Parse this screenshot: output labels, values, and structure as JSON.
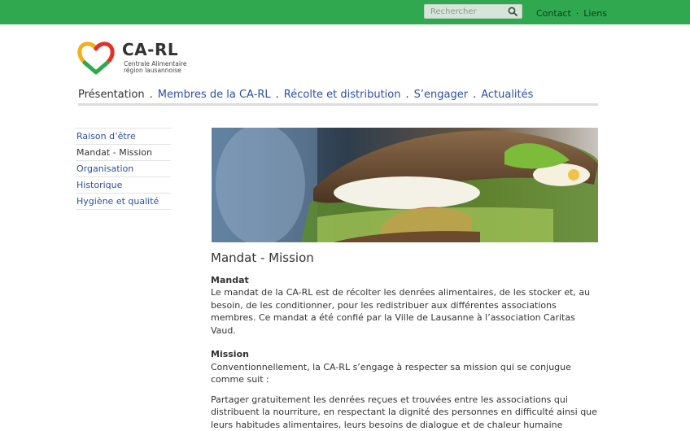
{
  "topbar": {
    "search_placeholder": "Rechercher",
    "links": [
      "Contact",
      "Liens"
    ]
  },
  "logo": {
    "name": "CA-RL",
    "subtitle_line1": "Centrale Alimentaire",
    "subtitle_line2": "région lausannoise"
  },
  "mainnav": {
    "items": [
      "Présentation",
      "Membres de la CA-RL",
      "Récolte et distribution",
      "S’engager",
      "Actualités"
    ],
    "active_index": 0
  },
  "sidenav": {
    "items": [
      "Raison d’être",
      "Mandat - Mission",
      "Organisation",
      "Historique",
      "Hygiène et qualité"
    ],
    "active_index": 1
  },
  "content": {
    "title": "Mandat - Mission",
    "mandat_heading": "Mandat",
    "mandat_text": "Le mandat de la CA-RL est de récolter les denrées alimentaires, de les stocker et, au besoin, de les conditionner, pour les redistribuer aux différentes associations membres. Ce mandat a été confié par la Ville de Lausanne à l’association Caritas Vaud.",
    "mission_heading": "Mission",
    "mission_intro": "Conventionnellement, la CA-RL s’engage à respecter sa mission qui se conjugue comme suit :",
    "mission_point": "Partager gratuitement les denrées reçues et trouvées entre les associations qui distribuent la nourriture, en respectant la dignité des personnes en difficulté ainsi que leurs habitudes alimentaires, leurs besoins de dialogue et de chaleur humaine"
  },
  "colors": {
    "topbar": "#2fa84f",
    "link": "#2b4fa8",
    "text": "#333333"
  },
  "icons": {
    "search": "search-icon",
    "logo": "heart-logo-icon"
  }
}
